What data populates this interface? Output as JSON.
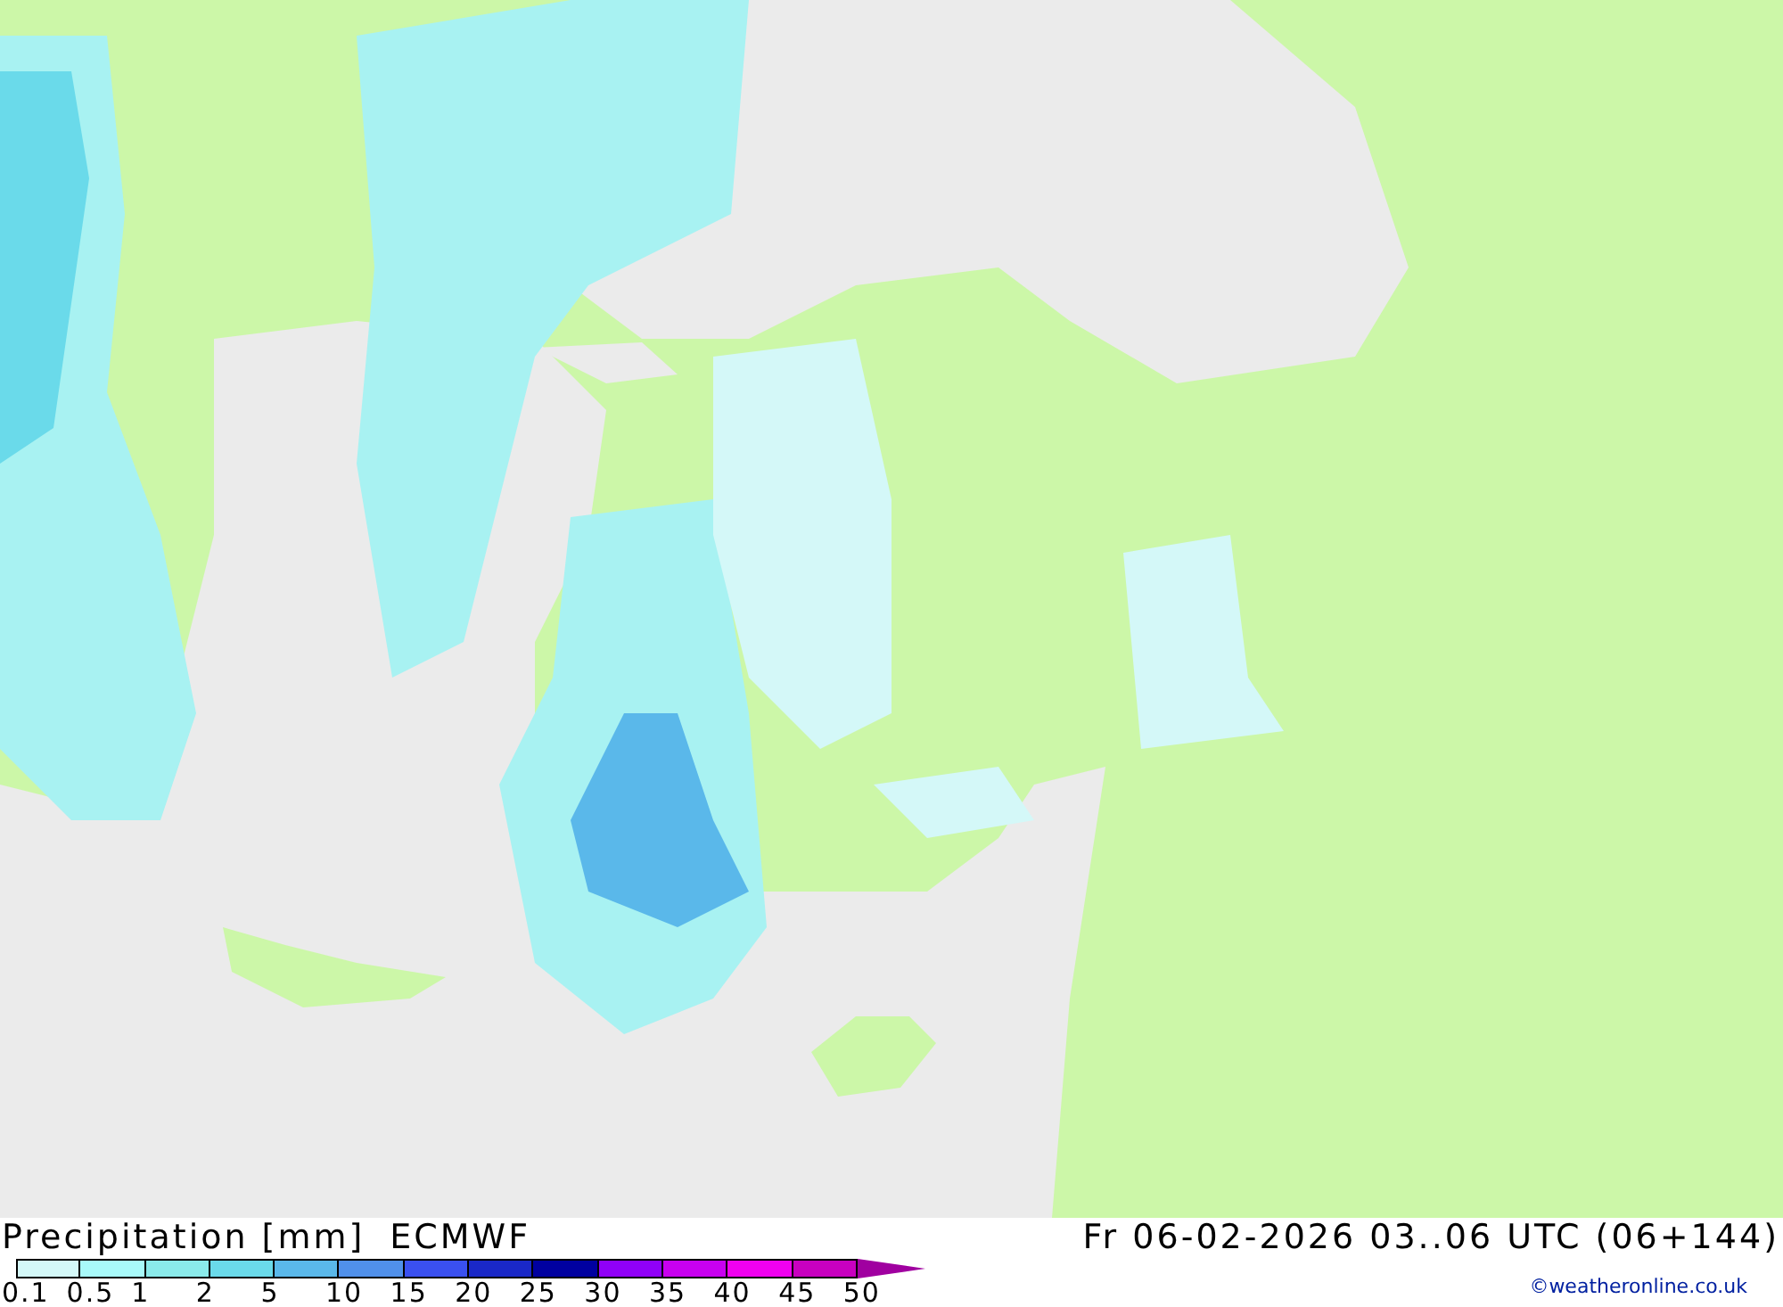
{
  "legend": {
    "title": "Precipitation [mm]",
    "model": "ECMWF",
    "valid_time": "Fr 06-02-2026 03..06 UTC (06+144)",
    "swatches": [
      {
        "kind": "box",
        "color": "#d4f8f8"
      },
      {
        "kind": "box",
        "color": "#a8fafa"
      },
      {
        "kind": "box",
        "color": "#8aeaea"
      },
      {
        "kind": "box",
        "color": "#6adaea"
      },
      {
        "kind": "box",
        "color": "#5ab8ea"
      },
      {
        "kind": "box",
        "color": "#5090ea"
      },
      {
        "kind": "box",
        "color": "#3a50f0"
      },
      {
        "kind": "box",
        "color": "#1a28c8"
      },
      {
        "kind": "box",
        "color": "#0000a0"
      },
      {
        "kind": "box",
        "color": "#9000f8"
      },
      {
        "kind": "box",
        "color": "#c800f0"
      },
      {
        "kind": "box",
        "color": "#f000f0"
      },
      {
        "kind": "box",
        "color": "#c800c0"
      },
      {
        "kind": "arrow",
        "color": "#a000a0"
      }
    ],
    "labels": [
      "0.1",
      "0.5",
      "1",
      "2",
      "5",
      "10",
      "15",
      "20",
      "25",
      "30",
      "35",
      "40",
      "45",
      "50"
    ],
    "credit": "©weatheronline.co.uk"
  }
}
